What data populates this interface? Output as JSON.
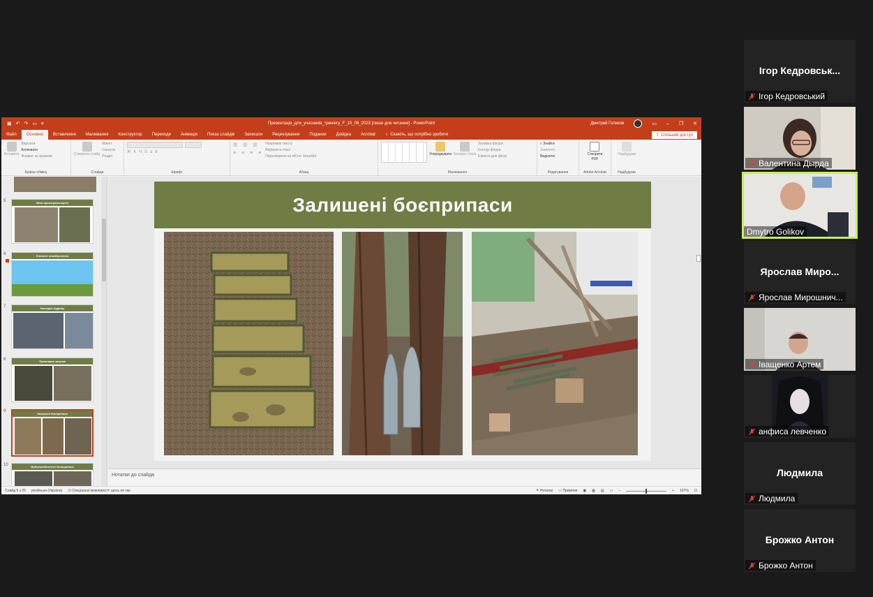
{
  "ppt": {
    "doc_title": "Презентація_для_учасників_тренінгу_F_15_06_2023 [лише для читання] - PowerPoint",
    "user_name": "Дмитрий Голиков",
    "tabs": [
      "Файл",
      "Основне",
      "Вставлення",
      "Малювання",
      "Конструктор",
      "Переходи",
      "Анімація",
      "Показ слайдів",
      "Записати",
      "Рецензування",
      "Подання",
      "Довідка",
      "Acrobat"
    ],
    "active_tab": "Основне",
    "search_placeholder": "Скажіть, що потрібно зробити",
    "share_label": "Спільний доступ",
    "ribbon": {
      "clipboard": {
        "label": "Буфер обміну",
        "paste": "Вставити",
        "cut": "Вирізати",
        "copy": "Копіювати",
        "format": "Формат за зразком"
      },
      "slides": {
        "label": "Слайди",
        "new_slide": "Створити слайд",
        "layout": "Макет",
        "reset": "Скинути",
        "section": "Розділ"
      },
      "font": {
        "label": "Шрифт"
      },
      "paragraph": {
        "label": "Абзац",
        "text_direction": "Напрямок тексту",
        "align_text": "Вирівняти текст",
        "smartart": "Перетворити на об'єкт SmartArt"
      },
      "drawing": {
        "label": "Малювання",
        "arrange": "Упорядкувати",
        "quick_styles": "Експрес-стилі",
        "fill": "Заливка фігури",
        "outline": "Контур фігури",
        "effects": "Ефекти для фігур"
      },
      "editing": {
        "label": "Редагування",
        "find": "Знайти",
        "replace": "Замінити",
        "select": "Виділити"
      },
      "acrobat": {
        "label": "Adobe Acrobat",
        "create_pdf_1": "Створити",
        "create_pdf_2": "PDF"
      },
      "designer": {
        "label": "Надбудови",
        "btn": "Надбудови"
      }
    },
    "thumbnails": [
      {
        "num": "5",
        "title": "Міни протитранспортні"
      },
      {
        "num": "6",
        "title": "Елемент невибухнення"
      },
      {
        "num": "7",
        "title": "Наслідки підриву"
      },
      {
        "num": "8",
        "title": "Прихована загроза"
      },
      {
        "num": "9",
        "title": "Залишені боєприпаси"
      },
      {
        "num": "10",
        "title": "Вибухонебезпечні боєприпаси"
      }
    ],
    "slide": {
      "title": "Залишені боєприпаси"
    },
    "notes_placeholder": "Нотатки до слайда",
    "status": {
      "slide_info": "Слайд 9 з 25",
      "language": "російська (Україна)",
      "accessibility": "Спеціальні можливості: щось не так",
      "notes": "Нотатки",
      "comments": "Примітки",
      "zoom": "107%"
    }
  },
  "participants": [
    {
      "tile_name": "Ігор  Кедровськ...",
      "label": "Ігор Кедровський",
      "muted": true,
      "video": false
    },
    {
      "tile_name": "",
      "label": "Валентина Дырда",
      "muted": true,
      "video": true
    },
    {
      "tile_name": "",
      "label": "Dmytro Golikov",
      "muted": false,
      "video": true,
      "active": true
    },
    {
      "tile_name": "Ярослав  Миро...",
      "label": "Ярослав Мирошнич...",
      "muted": true,
      "video": false
    },
    {
      "tile_name": "",
      "label": "Іващенко Артем",
      "muted": true,
      "video": true
    },
    {
      "tile_name": "",
      "label": "анфиса левченко",
      "muted": true,
      "video": true
    },
    {
      "tile_name": "Людмила",
      "label": "Людмила",
      "muted": true,
      "video": false
    },
    {
      "tile_name": "Брожко Антон",
      "label": "Брожко Антон",
      "muted": true,
      "video": false
    }
  ],
  "colors": {
    "ppt_accent": "#c43e1c",
    "slide_green": "#6f7d45",
    "active_speaker": "#c7ee55",
    "muted_red": "#e0413b"
  }
}
